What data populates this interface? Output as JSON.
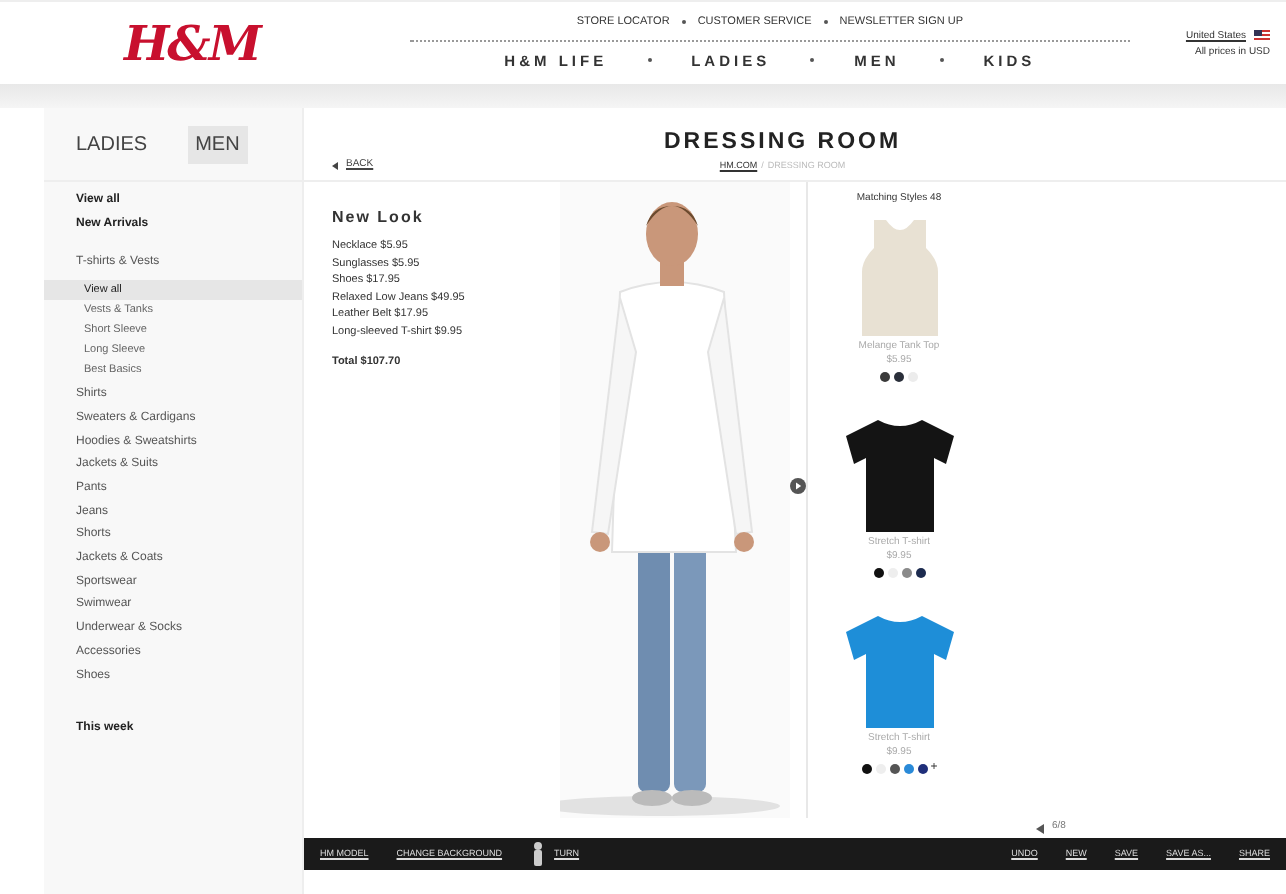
{
  "header": {
    "logo": "H&M",
    "top_links": [
      "STORE LOCATOR",
      "CUSTOMER SERVICE",
      "NEWSLETTER SIGN UP"
    ],
    "nav": [
      "H&M LIFE",
      "LADIES",
      "MEN",
      "KIDS"
    ],
    "country": "United States",
    "currency_note": "All prices in USD"
  },
  "gender_tabs": [
    {
      "label": "LADIES",
      "selected": false
    },
    {
      "label": "MEN",
      "selected": true
    }
  ],
  "sidebar": {
    "items": [
      {
        "label": "View all",
        "bold": true,
        "selected": false
      },
      {
        "label": "New Arrivals",
        "bold": true,
        "selected": false
      },
      {
        "label": "T-shirts & Vests",
        "bold": false,
        "selected": false,
        "children": [
          {
            "label": "View all",
            "selected": true
          },
          {
            "label": "Vests & Tanks",
            "selected": false
          },
          {
            "label": "Short Sleeve",
            "selected": false
          },
          {
            "label": "Long Sleeve",
            "selected": false
          },
          {
            "label": "Best Basics",
            "selected": false
          }
        ]
      },
      {
        "label": "Shirts",
        "bold": false,
        "selected": false
      },
      {
        "label": "Sweaters & Cardigans",
        "bold": false,
        "selected": false
      },
      {
        "label": "Hoodies & Sweatshirts",
        "bold": false,
        "selected": false
      },
      {
        "label": "Jackets & Suits",
        "bold": false,
        "selected": false
      },
      {
        "label": "Pants",
        "bold": false,
        "selected": false
      },
      {
        "label": "Jeans",
        "bold": false,
        "selected": false
      },
      {
        "label": "Shorts",
        "bold": false,
        "selected": false
      },
      {
        "label": "Jackets & Coats",
        "bold": false,
        "selected": false
      },
      {
        "label": "Sportswear",
        "bold": false,
        "selected": false
      },
      {
        "label": "Swimwear",
        "bold": false,
        "selected": false
      },
      {
        "label": "Underwear & Socks",
        "bold": false,
        "selected": false
      },
      {
        "label": "Accessories",
        "bold": false,
        "selected": false
      },
      {
        "label": "Shoes",
        "bold": false,
        "selected": false
      }
    ],
    "footer_item": "This week"
  },
  "back_link": "BACK",
  "title": "DRESSING ROOM",
  "breadcrumb": [
    "HM.COM",
    "/",
    "DRESSING ROOM"
  ],
  "look": {
    "title": "New Look",
    "items": [
      "Necklace $5.95",
      "Sunglasses $5.95",
      "Shoes $17.95",
      "Relaxed Low Jeans $49.95",
      "Leather Belt  $17.95",
      "Long-sleeved T-shirt $9.95"
    ],
    "total": "Total $107.70"
  },
  "model": {
    "kind": "picture"
  },
  "matching": {
    "heading": "Matching Styles 48",
    "products": [
      {
        "kind": "tank",
        "name": "Melange Tank Top",
        "price": "$5.95",
        "swatches": [
          {
            "color": "#3a3a3a"
          },
          {
            "color": "#2a2f3a"
          },
          {
            "color": "#ececec"
          }
        ]
      },
      {
        "kind": "tee",
        "name": "Stretch T-shirt",
        "price": "$9.95",
        "swatches": [
          {
            "color": "#111111"
          },
          {
            "color": "#eeeeee"
          },
          {
            "color": "#8a8a8a"
          },
          {
            "color": "#1c2b4f"
          }
        ]
      },
      {
        "kind": "tee",
        "name": "Stretch T-shirt",
        "price": "$9.95",
        "swatches": [
          {
            "color": "#111111"
          },
          {
            "color": "#eeeeee"
          },
          {
            "color": "#555555"
          },
          {
            "color": "#2a8ad8"
          },
          {
            "color": "#1f2f7a"
          }
        ],
        "more_label": "+"
      }
    ]
  },
  "pager": "6/8",
  "toolbar": {
    "left": [
      "HM MODEL",
      "CHANGE BACKGROUND",
      "TURN"
    ],
    "right": [
      "UNDO",
      "NEW",
      "SAVE",
      "SAVE AS...",
      "SHARE"
    ]
  }
}
